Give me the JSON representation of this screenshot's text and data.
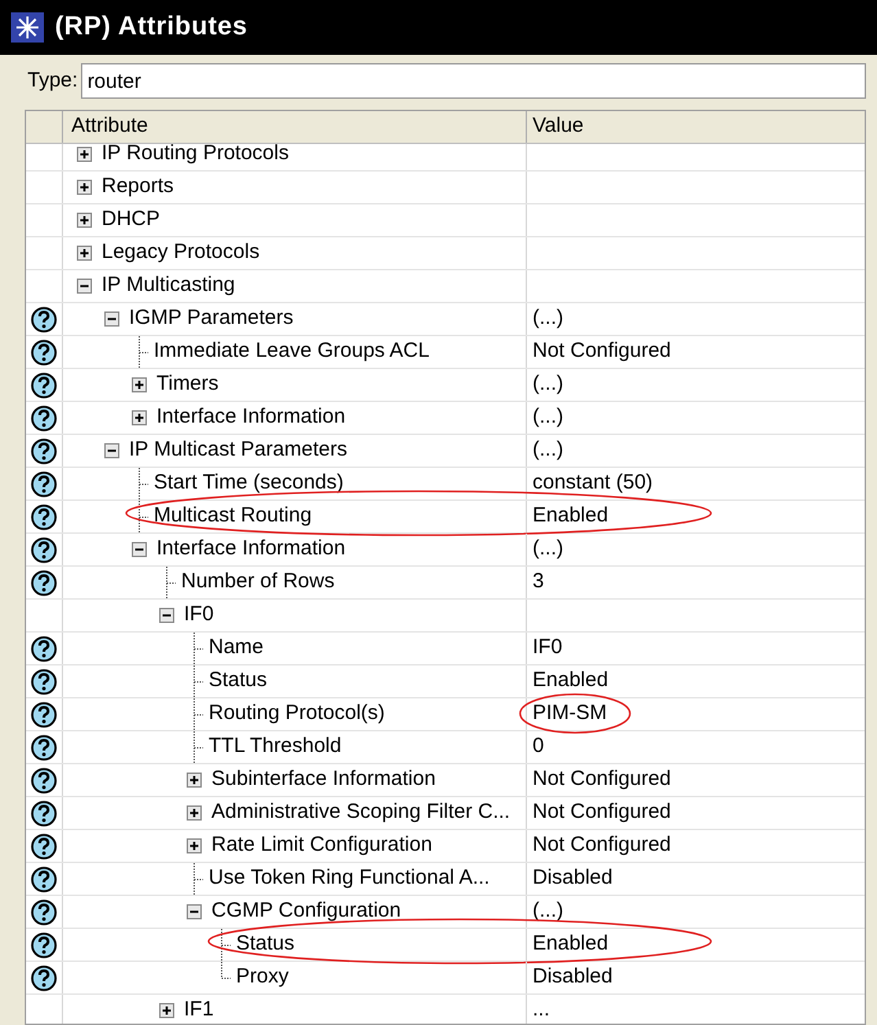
{
  "window": {
    "title": "(RP) Attributes"
  },
  "type_field": {
    "label": "Type:",
    "value": "router"
  },
  "table": {
    "columns": [
      "Attribute",
      "Value"
    ],
    "rows": [
      {
        "name": "IP Routing Protocols",
        "help": false,
        "expanded": false
      },
      {
        "name": "Reports",
        "help": false,
        "expanded": false
      },
      {
        "name": "DHCP",
        "help": false,
        "expanded": false
      },
      {
        "name": "Legacy Protocols",
        "help": false,
        "expanded": false
      },
      {
        "name": "IP Multicasting",
        "help": false,
        "expanded": true,
        "children": [
          {
            "name": "IGMP Parameters",
            "value": "(...)",
            "help": true,
            "expanded": true,
            "children": [
              {
                "name": "Immediate Leave Groups ACL",
                "value": "Not Configured",
                "help": true
              },
              {
                "name": "Timers",
                "value": "(...)",
                "help": true,
                "expanded": false
              },
              {
                "name": "Interface Information",
                "value": "(...)",
                "help": true,
                "expanded": false
              }
            ]
          },
          {
            "name": "IP Multicast Parameters",
            "value": "(...)",
            "help": true,
            "expanded": true,
            "children": [
              {
                "name": "Start Time (seconds)",
                "value": "constant (50)",
                "help": true
              },
              {
                "name": "Multicast Routing",
                "value": "Enabled",
                "help": true,
                "circled": true
              },
              {
                "name": "Interface Information",
                "value": "(...)",
                "help": true,
                "expanded": true,
                "children": [
                  {
                    "name": "Number of Rows",
                    "value": "3",
                    "help": true
                  },
                  {
                    "name": "IF0",
                    "help": false,
                    "expanded": true,
                    "children": [
                      {
                        "name": "Name",
                        "value": "IF0",
                        "help": true
                      },
                      {
                        "name": "Status",
                        "value": "Enabled",
                        "help": true
                      },
                      {
                        "name": "Routing Protocol(s)",
                        "value": "PIM-SM",
                        "help": true,
                        "value_circled": true
                      },
                      {
                        "name": "TTL Threshold",
                        "value": "0",
                        "help": true
                      },
                      {
                        "name": "Subinterface Information",
                        "value": "Not Configured",
                        "help": true,
                        "expanded": false
                      },
                      {
                        "name": "Administrative Scoping Filter C...",
                        "value": "Not Configured",
                        "help": true,
                        "expanded": false
                      },
                      {
                        "name": "Rate Limit Configuration",
                        "value": "Not Configured",
                        "help": true,
                        "expanded": false
                      },
                      {
                        "name": "Use Token Ring Functional A...",
                        "value": "Disabled",
                        "help": true
                      },
                      {
                        "name": "CGMP Configuration",
                        "value": "(...)",
                        "help": true,
                        "expanded": true,
                        "children": [
                          {
                            "name": "Status",
                            "value": "Enabled",
                            "help": true,
                            "circled": true
                          },
                          {
                            "name": "Proxy",
                            "value": "Disabled",
                            "help": true
                          }
                        ]
                      }
                    ]
                  },
                  {
                    "name": "IF1",
                    "value": "...",
                    "help": false,
                    "expanded": false
                  }
                ]
              }
            ]
          }
        ]
      }
    ]
  }
}
